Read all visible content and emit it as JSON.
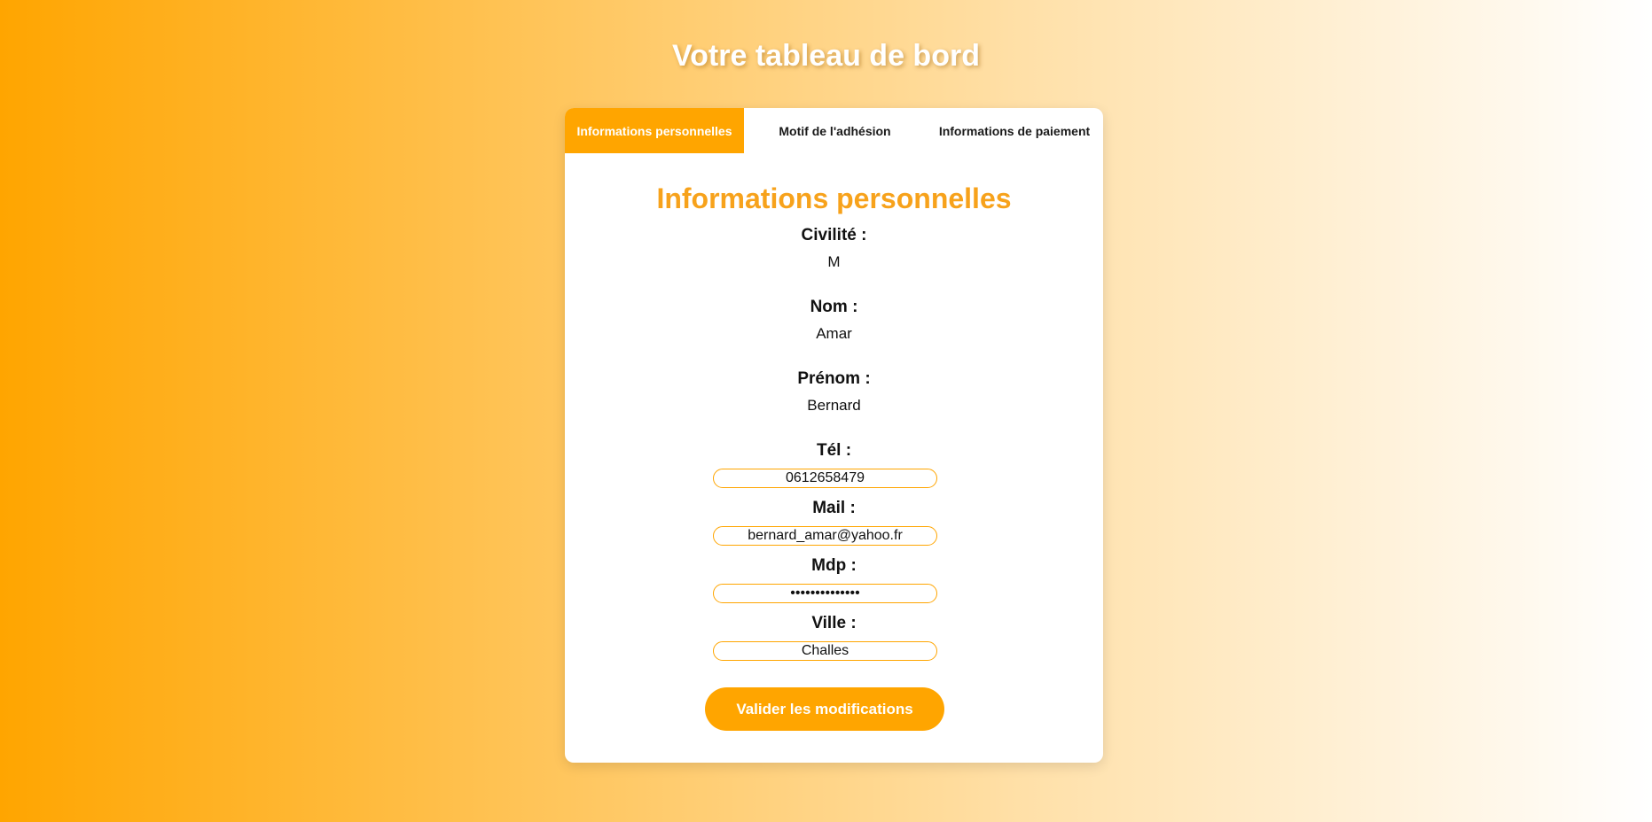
{
  "page": {
    "title": "Votre tableau de bord"
  },
  "tabs": [
    {
      "label": "Informations personnelles",
      "active": true
    },
    {
      "label": "Motif de l'adhésion",
      "active": false
    },
    {
      "label": "Informations de paiement",
      "active": false
    }
  ],
  "section": {
    "title": "Informations personnelles"
  },
  "static_fields": [
    {
      "label": "Civilité :",
      "value": "M"
    },
    {
      "label": "Nom :",
      "value": "Amar"
    },
    {
      "label": "Prénom :",
      "value": "Bernard"
    }
  ],
  "input_fields": [
    {
      "label": "Tél :",
      "value": "0612658479",
      "type": "text"
    },
    {
      "label": "Mail :",
      "value": "bernard_amar@yahoo.fr",
      "type": "text"
    },
    {
      "label": "Mdp :",
      "value": "••••••••••••••",
      "type": "password"
    },
    {
      "label": "Ville :",
      "value": "Challes",
      "type": "text"
    }
  ],
  "submit": {
    "label": "Valider les modifications"
  },
  "colors": {
    "accent": "#ffa500",
    "title_orange": "#f7a21b"
  }
}
